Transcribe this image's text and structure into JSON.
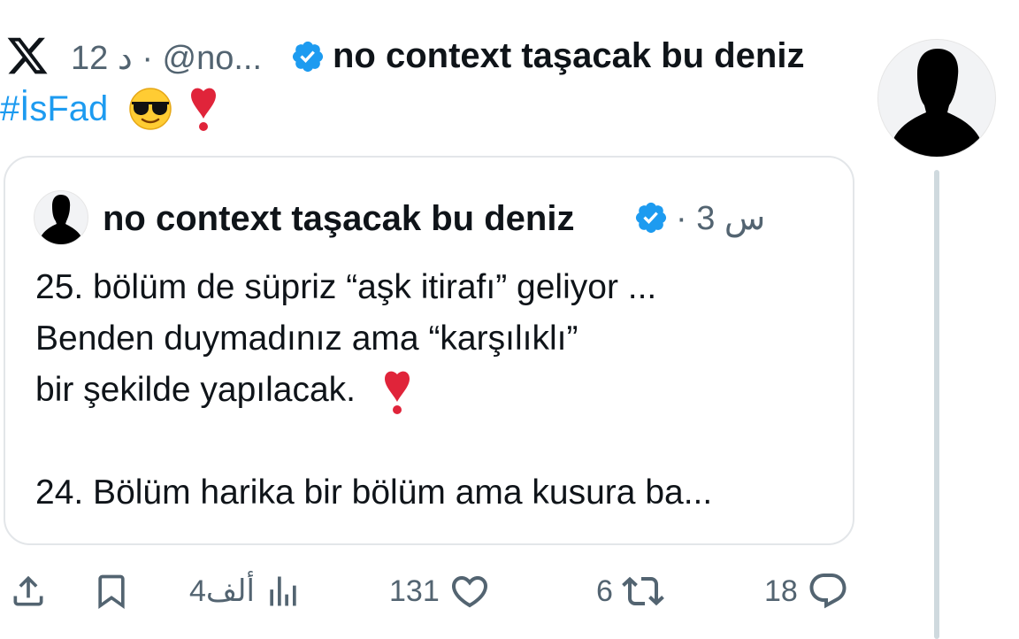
{
  "header": {
    "time": "12 د",
    "dot": "·",
    "handle": "@no...",
    "author": "no context taşacak bu deniz",
    "hashtag": "#İsFad"
  },
  "quote": {
    "author": "no context taşacak bu deniz",
    "dot": "·",
    "time": "3 س",
    "lines": [
      "25. bölüm de süpriz “aşk itirafı” geliyor ...",
      "Benden duymadınız ama “karşılıklı”",
      "bir şekilde yapılacak.",
      "",
      "24. Bölüm harika bir bölüm ama kusura ba..."
    ]
  },
  "actions": {
    "views": "4ألف",
    "likes": "131",
    "retweets": "6",
    "replies": "18"
  },
  "icons": {
    "logo": "x-logo-icon",
    "verified": "verified-badge-icon",
    "cool": "sunglasses-emoji-icon",
    "exclamation": "red-exclamation-icon",
    "share": "share-icon",
    "bookmark": "bookmark-icon",
    "views": "views-icon",
    "like": "heart-icon",
    "retweet": "retweet-icon",
    "reply": "reply-icon"
  },
  "colors": {
    "accent": "#1d9bf0",
    "muted": "#536471",
    "emoji_red": "#e0243a"
  }
}
